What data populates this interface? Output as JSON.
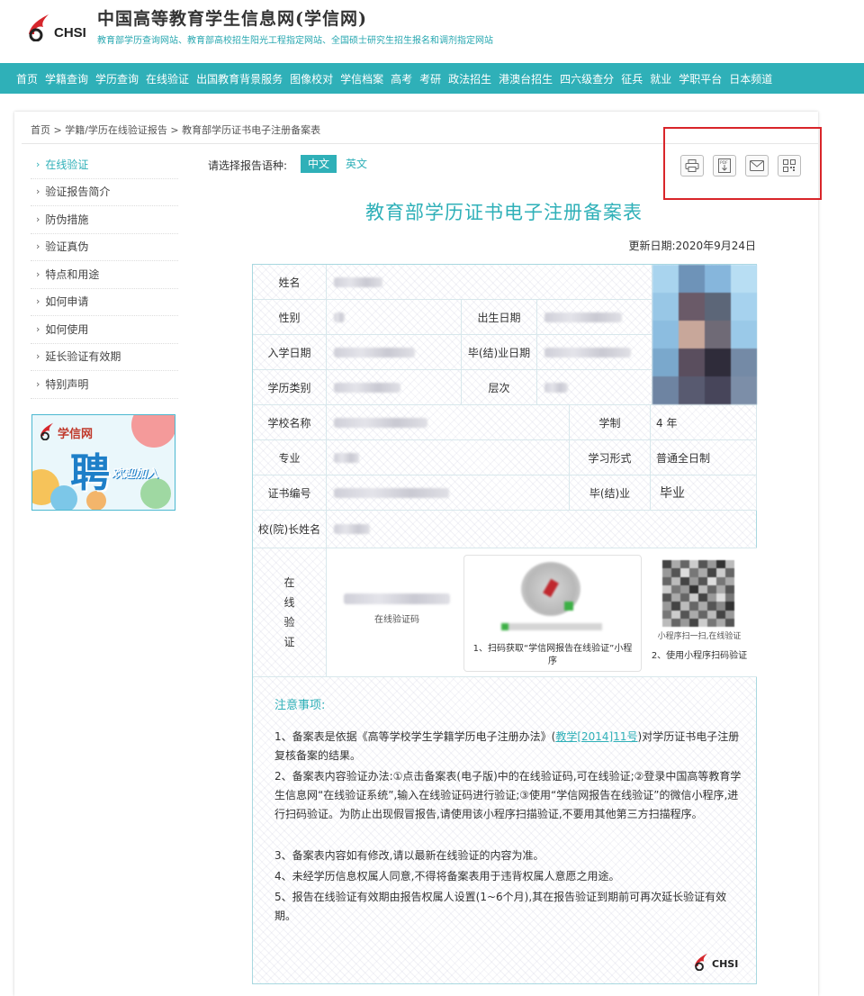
{
  "header": {
    "logo_text": "CHSI",
    "title": "中国高等教育学生信息网(学信网)",
    "subtitle": "教育部学历查询网站、教育部高校招生阳光工程指定网站、全国硕士研究生招生报名和调剂指定网站"
  },
  "nav": {
    "items": [
      "首页",
      "学籍查询",
      "学历查询",
      "在线验证",
      "出国教育背景服务",
      "图像校对",
      "学信档案",
      "高考",
      "考研",
      "政法招生",
      "港澳台招生",
      "四六级查分",
      "征兵",
      "就业",
      "学职平台",
      "日本频道"
    ]
  },
  "breadcrumb": "首页 > 学籍/学历在线验证报告 > 教育部学历证书电子注册备案表",
  "sidebar": {
    "items": [
      "在线验证",
      "验证报告简介",
      "防伪措施",
      "验证真伪",
      "特点和用途",
      "如何申请",
      "如何使用",
      "延长验证有效期",
      "特别声明"
    ]
  },
  "banner": {
    "brand": "学信网",
    "big": "聘",
    "small": "欢迎加入"
  },
  "report": {
    "lang_label": "请选择报告语种:",
    "lang_cn": "中文",
    "lang_en": "英文",
    "title": "教育部学历证书电子注册备案表",
    "update_date": "更新日期:2020年9月24日",
    "labels": {
      "name": "姓名",
      "gender": "性别",
      "birth": "出生日期",
      "enroll": "入学日期",
      "graduate_date": "毕(结)业日期",
      "edu_type": "学历类别",
      "level": "层次",
      "school": "学校名称",
      "length": "学制",
      "major": "专业",
      "study_form": "学习形式",
      "cert_no": "证书编号",
      "grad_status": "毕(结)业",
      "president": "校(院)长姓名",
      "online_verify": [
        "在",
        "线",
        "验",
        "证"
      ]
    },
    "values": {
      "length": "4 年",
      "study_form": "普通全日制",
      "grad_status": "毕业"
    },
    "verify": {
      "code_label": "在线验证码",
      "qr1_caption": "1、扫码获取“学信网报告在线验证”小程序",
      "qr2_hint": "小程序扫一扫,在线验证",
      "qr2_caption": "2、使用小程序扫码验证"
    },
    "notice": {
      "title": "注意事项:",
      "item1_a": "1、备案表是依据《高等学校学生学籍学历电子注册办法》(",
      "item1_link": "教学[2014]11号",
      "item1_b": ")对学历证书电子注册复核备案的结果。",
      "item2": "2、备案表内容验证办法:①点击备案表(电子版)中的在线验证码,可在线验证;②登录中国高等教育学生信息网“在线验证系统”,输入在线验证码进行验证;③使用“学信网报告在线验证”的微信小程序,进行扫码验证。为防止出现假冒报告,请使用该小程序扫描验证,不要用其他第三方扫描程序。",
      "item3": "3、备案表内容如有修改,请以最新在线验证的内容为准。",
      "item4": "4、未经学历信息权属人同意,不得将备案表用于违背权属人意愿之用途。",
      "item5": "5、报告在线验证有效期由报告权属人设置(1~6个月),其在报告验证到期前可再次延长验证有效期。"
    },
    "footer_logo": "CHSI"
  },
  "colors": {
    "accent": "#2fb0b8",
    "highlight_box": "#d9252a"
  },
  "icons": [
    "print-icon",
    "pdf-download-icon",
    "mail-icon",
    "qrcode-icon"
  ]
}
